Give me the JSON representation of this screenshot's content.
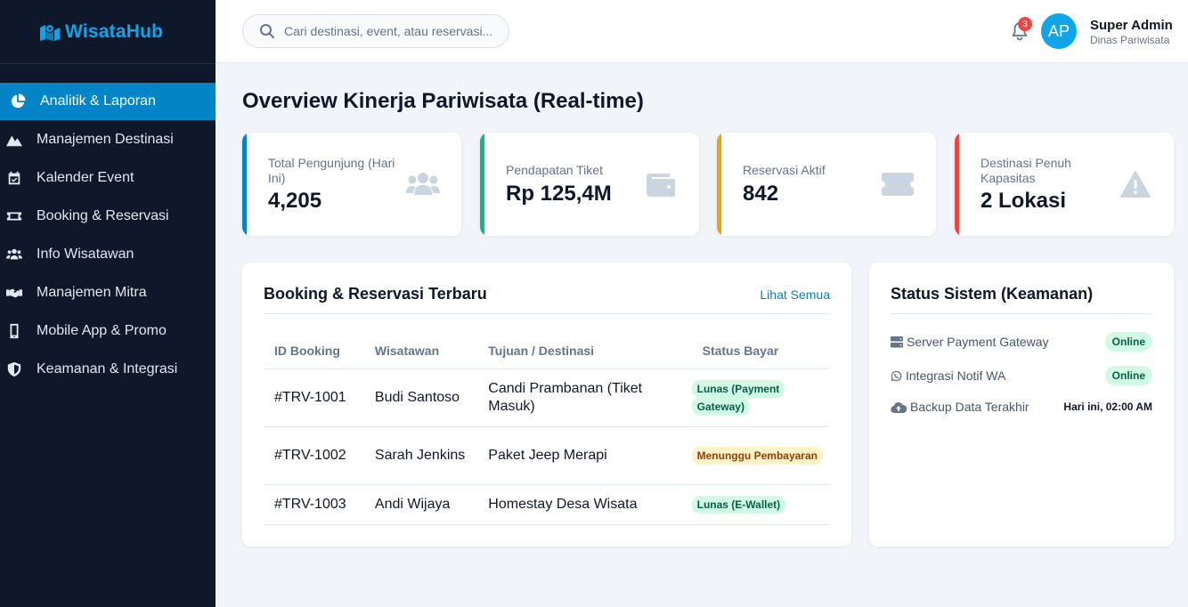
{
  "app": {
    "name": "WisataHub"
  },
  "sidebar": {
    "items": [
      {
        "label": "Analitik & Laporan",
        "icon": "chart-pie-icon",
        "active": true
      },
      {
        "label": "Manajemen Destinasi",
        "icon": "mountain-icon"
      },
      {
        "label": "Kalender Event",
        "icon": "calendar-check-icon"
      },
      {
        "label": "Booking & Reservasi",
        "icon": "ticket-icon"
      },
      {
        "label": "Info Wisatawan",
        "icon": "users-icon"
      },
      {
        "label": "Manajemen Mitra",
        "icon": "handshake-icon"
      },
      {
        "label": "Mobile App & Promo",
        "icon": "mobile-icon"
      },
      {
        "label": "Keamanan & Integrasi",
        "icon": "shield-icon"
      }
    ]
  },
  "topbar": {
    "search_placeholder": "Cari destinasi, event, atau reservasi...",
    "notification_count": "3",
    "avatar_initials": "AP",
    "user_name": "Super Admin",
    "user_role": "Dinas Pariwisata"
  },
  "main": {
    "title": "Overview Kinerja Pariwisata (Real-time)",
    "stats": [
      {
        "label": "Total Pengunjung (Hari Ini)",
        "value": "4,205",
        "color": "#0284c7",
        "icon": "users-icon"
      },
      {
        "label": "Pendapatan Tiket",
        "value": "Rp 125,4M",
        "color": "#10b981",
        "icon": "wallet-icon"
      },
      {
        "label": "Reservasi Aktif",
        "value": "842",
        "color": "#f59e0b",
        "icon": "ticket-icon"
      },
      {
        "label": "Destinasi Penuh Kapasitas",
        "value": "2 Lokasi",
        "color": "#ef4444",
        "icon": "warning-icon"
      }
    ],
    "bookings": {
      "title": "Booking & Reservasi Terbaru",
      "see_all": "Lihat Semua",
      "columns": [
        "ID Booking",
        "Wisatawan",
        "Tujuan / Destinasi",
        "Status Bayar"
      ],
      "rows": [
        {
          "id": "#TRV-1001",
          "tourist": "Budi Santoso",
          "destination": "Candi Prambanan (Tiket Masuk)",
          "status": "Lunas (Payment Gateway)",
          "status_type": "ok"
        },
        {
          "id": "#TRV-1002",
          "tourist": "Sarah Jenkins",
          "destination": "Paket Jeep Merapi",
          "status": "Menunggu Pembayaran",
          "status_type": "warn"
        },
        {
          "id": "#TRV-1003",
          "tourist": "Andi Wijaya",
          "destination": "Homestay Desa Wisata",
          "status": "Lunas (E-Wallet)",
          "status_type": "ok"
        }
      ]
    },
    "system": {
      "title": "Status Sistem (Keamanan)",
      "items": [
        {
          "label": "Server Payment Gateway",
          "value": "Online",
          "icon": "server-icon"
        },
        {
          "label": "Integrasi Notif WA",
          "value": "Online",
          "icon": "whatsapp-icon"
        },
        {
          "label": "Backup Data Terakhir",
          "value": "Hari ini, 02:00 AM",
          "icon": "cloud-upload-icon"
        }
      ]
    }
  }
}
